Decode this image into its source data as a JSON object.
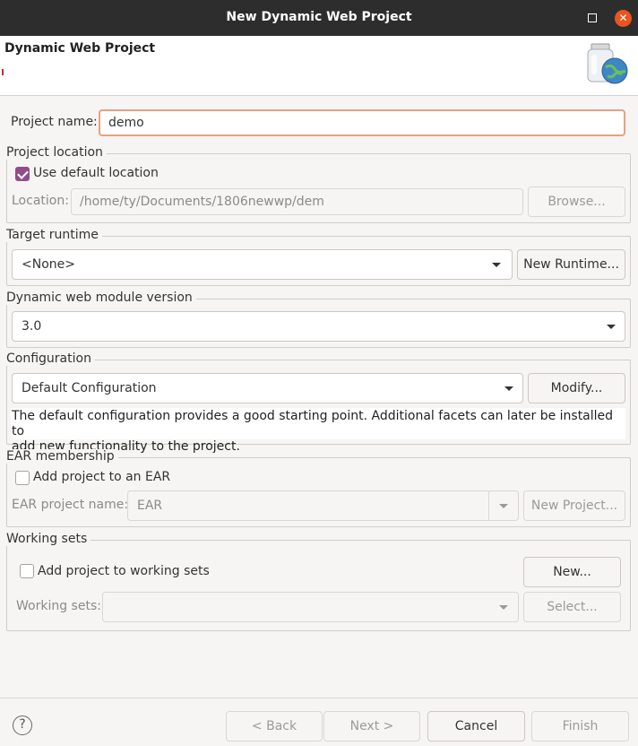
{
  "window": {
    "title": "New Dynamic Web Project",
    "close_glyph": "✕"
  },
  "banner": {
    "heading": "Dynamic Web Project",
    "icon": "web-project-jar-globe-icon"
  },
  "project": {
    "name_label": "Project name:",
    "name_value": "demo"
  },
  "location": {
    "group_title": "Project location",
    "use_default_label": "Use default location",
    "use_default_checked": true,
    "location_label": "Location:",
    "location_value": "/home/ty/Documents/1806newwp/dem",
    "browse_label": "Browse..."
  },
  "runtime": {
    "group_title": "Target runtime",
    "selected": "<None>",
    "new_runtime_label": "New Runtime..."
  },
  "module": {
    "group_title": "Dynamic web module version",
    "selected": "3.0"
  },
  "configuration": {
    "group_title": "Configuration",
    "selected": "Default Configuration",
    "modify_label": "Modify...",
    "description_line1": "The default configuration provides a good starting point. Additional facets can later be installed to",
    "description_line2": "add new functionality to the project."
  },
  "ear": {
    "group_title": "EAR membership",
    "add_label": "Add project to an EAR",
    "add_checked": false,
    "project_name_label": "EAR project name:",
    "project_name_value": "EAR",
    "new_project_label": "New Project..."
  },
  "working_sets": {
    "group_title": "Working sets",
    "add_label": "Add project to working sets",
    "add_checked": false,
    "new_label": "New...",
    "sets_label": "Working sets:",
    "sets_value": "",
    "select_label": "Select..."
  },
  "footer": {
    "help_glyph": "?",
    "back_label": "< Back",
    "next_label": "Next >",
    "cancel_label": "Cancel",
    "finish_label": "Finish"
  },
  "colors": {
    "accent": "#924d8b",
    "focus_border": "#e9a080",
    "titlebar": "#2d2d2d",
    "close_button": "#e95420"
  }
}
